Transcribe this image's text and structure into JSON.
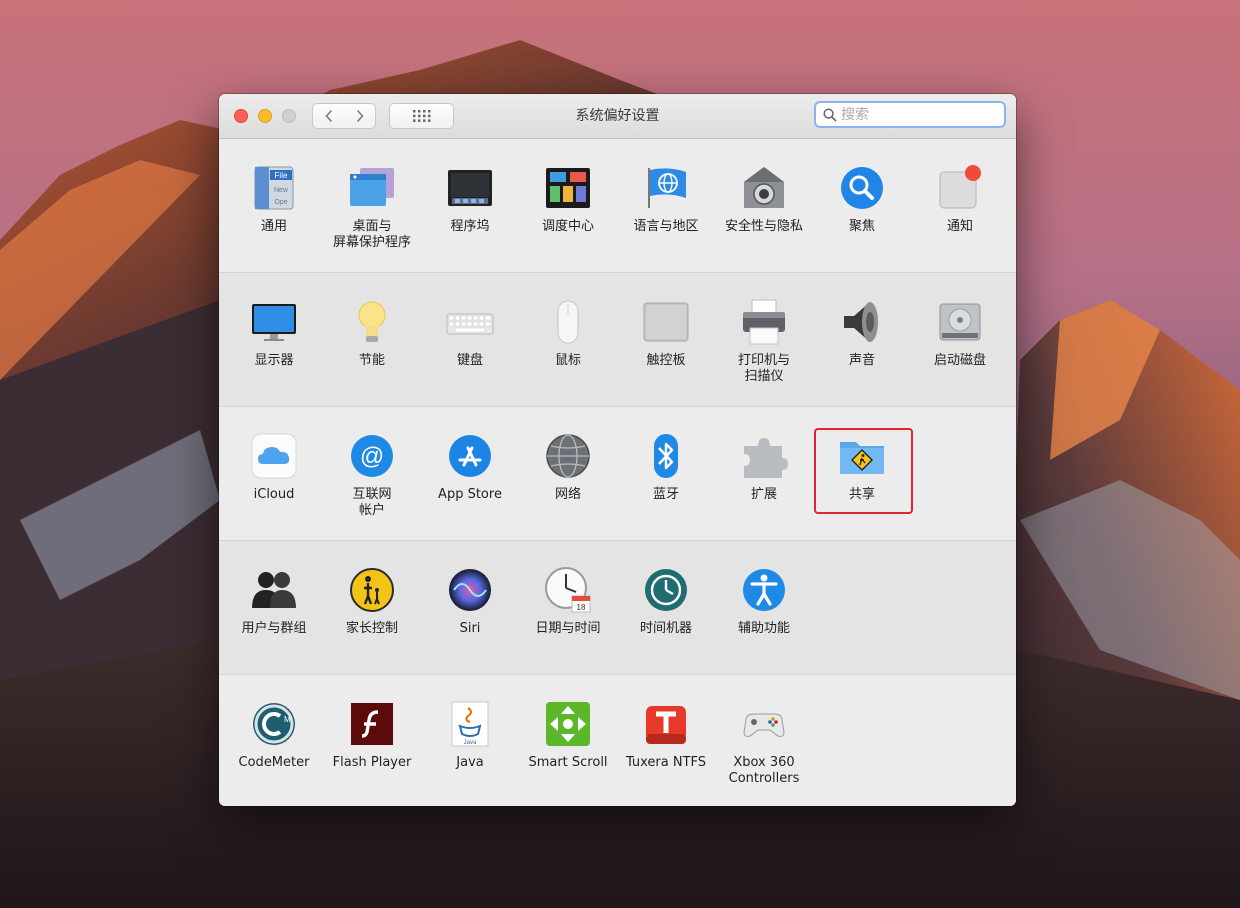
{
  "window": {
    "title": "系统偏好设置",
    "search": {
      "value": "",
      "placeholder": "搜索"
    }
  },
  "sections": [
    {
      "panes": [
        {
          "id": "general",
          "label": "通用",
          "icon": "general-icon"
        },
        {
          "id": "desktop",
          "label": "桌面与\n屏幕保护程序",
          "icon": "desktop-screensaver-icon"
        },
        {
          "id": "dock",
          "label": "程序坞",
          "icon": "dock-icon"
        },
        {
          "id": "mission-control",
          "label": "调度中心",
          "icon": "mission-control-icon"
        },
        {
          "id": "language",
          "label": "语言与地区",
          "icon": "language-region-icon"
        },
        {
          "id": "security",
          "label": "安全性与隐私",
          "icon": "security-privacy-icon"
        },
        {
          "id": "spotlight",
          "label": "聚焦",
          "icon": "spotlight-icon"
        },
        {
          "id": "notifications",
          "label": "通知",
          "icon": "notifications-icon"
        }
      ]
    },
    {
      "panes": [
        {
          "id": "displays",
          "label": "显示器",
          "icon": "display-icon"
        },
        {
          "id": "energy",
          "label": "节能",
          "icon": "energy-saver-icon"
        },
        {
          "id": "keyboard",
          "label": "键盘",
          "icon": "keyboard-icon"
        },
        {
          "id": "mouse",
          "label": "鼠标",
          "icon": "mouse-icon"
        },
        {
          "id": "trackpad",
          "label": "触控板",
          "icon": "trackpad-icon"
        },
        {
          "id": "printers",
          "label": "打印机与\n扫描仪",
          "icon": "printer-icon"
        },
        {
          "id": "sound",
          "label": "声音",
          "icon": "sound-icon"
        },
        {
          "id": "startup-disk",
          "label": "启动磁盘",
          "icon": "startup-disk-icon"
        }
      ]
    },
    {
      "panes": [
        {
          "id": "icloud",
          "label": "iCloud",
          "icon": "icloud-icon"
        },
        {
          "id": "internet-accounts",
          "label": "互联网\n帐户",
          "icon": "internet-accounts-icon"
        },
        {
          "id": "app-store",
          "label": "App Store",
          "icon": "app-store-icon"
        },
        {
          "id": "network",
          "label": "网络",
          "icon": "network-icon"
        },
        {
          "id": "bluetooth",
          "label": "蓝牙",
          "icon": "bluetooth-icon"
        },
        {
          "id": "extensions",
          "label": "扩展",
          "icon": "extensions-icon"
        },
        {
          "id": "sharing",
          "label": "共享",
          "icon": "sharing-icon",
          "highlighted": true
        }
      ]
    },
    {
      "panes": [
        {
          "id": "users",
          "label": "用户与群组",
          "icon": "users-groups-icon"
        },
        {
          "id": "parental",
          "label": "家长控制",
          "icon": "parental-controls-icon"
        },
        {
          "id": "siri",
          "label": "Siri",
          "icon": "siri-icon"
        },
        {
          "id": "date-time",
          "label": "日期与时间",
          "icon": "date-time-icon"
        },
        {
          "id": "time-machine",
          "label": "时间机器",
          "icon": "time-machine-icon"
        },
        {
          "id": "accessibility",
          "label": "辅助功能",
          "icon": "accessibility-icon"
        }
      ]
    },
    {
      "panes": [
        {
          "id": "codemeter",
          "label": "CodeMeter",
          "icon": "codemeter-icon"
        },
        {
          "id": "flash",
          "label": "Flash Player",
          "icon": "flash-player-icon"
        },
        {
          "id": "java",
          "label": "Java",
          "icon": "java-icon"
        },
        {
          "id": "smart-scroll",
          "label": "Smart Scroll",
          "icon": "smart-scroll-icon"
        },
        {
          "id": "tuxera",
          "label": "Tuxera NTFS",
          "icon": "tuxera-ntfs-icon"
        },
        {
          "id": "xbox",
          "label": "Xbox 360\nControllers",
          "icon": "xbox-controller-icon"
        }
      ]
    }
  ],
  "colors": {
    "highlight": "#e2242c",
    "search_focus": "#8cb4ec"
  }
}
